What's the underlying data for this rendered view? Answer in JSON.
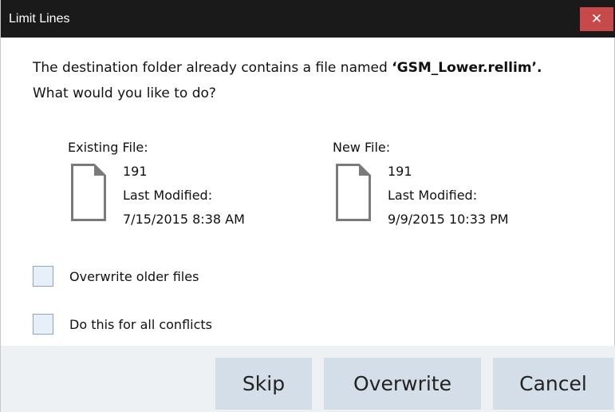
{
  "dialog": {
    "title": "Limit Lines",
    "close_glyph": "✕"
  },
  "message": {
    "line1_prefix": "The destination folder already contains a file named ",
    "filename": "‘GSM_Lower.rellim’.",
    "line2": "What would you like to do?"
  },
  "existing_file": {
    "heading": "Existing File:",
    "size": "191",
    "modified_label": "Last Modified:",
    "modified": "7/15/2015 8:38 AM",
    "icon": "file-icon"
  },
  "new_file": {
    "heading": "New File:",
    "size": "191",
    "modified_label": "Last Modified:",
    "modified": "9/9/2015 10:33 PM",
    "icon": "file-icon"
  },
  "options": {
    "overwrite_older": {
      "label": "Overwrite older files",
      "checked": false
    },
    "all_conflicts": {
      "label": "Do this for all conflicts",
      "checked": false
    }
  },
  "buttons": {
    "skip": "Skip",
    "overwrite": "Overwrite",
    "cancel": "Cancel"
  },
  "colors": {
    "titlebar": "#1a1a1a",
    "close": "#c8494a",
    "button": "#d3dee8",
    "footer": "#eef1f4",
    "checkbox": "#e7f0f9"
  }
}
